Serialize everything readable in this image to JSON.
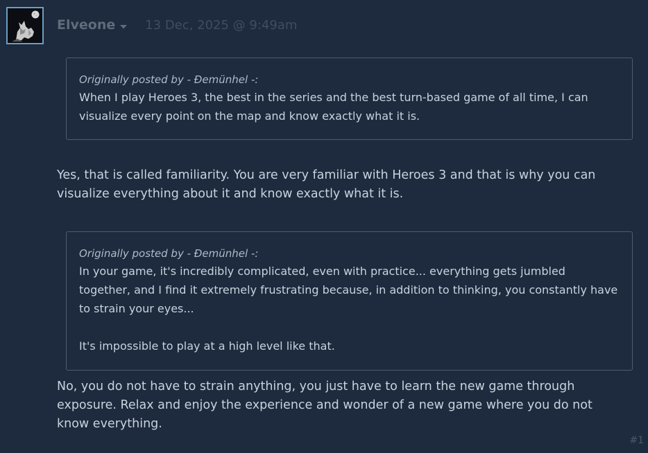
{
  "post": {
    "author": "Elveone",
    "date": "13 Dec, 2025 @ 9:49am",
    "number": "#1",
    "quotes": [
      {
        "label": "Originally posted by",
        "author": "- Ðemünhel -:",
        "paragraphs": [
          "When I play Heroes 3, the best in the series and the best turn-based game of all time, I can visualize every point on the map and know exactly what it is."
        ]
      },
      {
        "label": "Originally posted by",
        "author": "- Ðemünhel -:",
        "paragraphs": [
          "In your game, it's incredibly complicated, even with practice... everything gets jumbled together, and I find it extremely frustrating because, in addition to thinking, you constantly have to strain your eyes...",
          "It's impossible to play at a high level like that."
        ]
      }
    ],
    "replies": [
      "Yes, that is called familiarity. You are very familiar with Heroes 3 and that is why you can visualize everything about it and know exactly what it is.",
      "No, you do not have to strain anything, you just have to learn the new game through exposure. Relax and enjoy the experience and wonder of a new game where you do not know everything."
    ]
  },
  "icons": {
    "avatar": "avatar-wolf-moon-image",
    "dropdown": "chevron-down-icon"
  },
  "colors": {
    "background": "#1e2a3d",
    "text": "#c6d4df",
    "author": "#5d6d7c",
    "date": "#3f4e5e",
    "quote_border": "#4e5d6d",
    "avatar_border": "#6aa0c0"
  }
}
